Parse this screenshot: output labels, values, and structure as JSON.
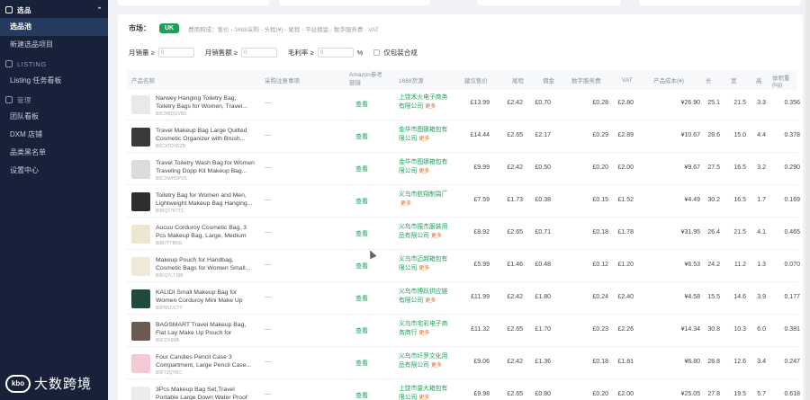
{
  "sidebar": {
    "sections": [
      {
        "label": "选品",
        "items": [
          {
            "label": "选品池",
            "active": true
          },
          {
            "label": "新建选品项目",
            "active": false
          }
        ]
      },
      {
        "label": "LISTING",
        "items": [
          {
            "label": "Listing 任务看板",
            "active": false
          }
        ]
      },
      {
        "label": "管理",
        "items": [
          {
            "label": "团队看板",
            "active": false
          },
          {
            "label": "DXM 店铺",
            "active": false
          },
          {
            "label": "品类黑名单",
            "active": false
          },
          {
            "label": "设置中心",
            "active": false
          }
        ]
      }
    ],
    "brand": {
      "logo": "kbo",
      "name": "大数跨境"
    }
  },
  "filters": {
    "market_label": "市场：",
    "market_value": "UK",
    "fee_text": "费用构成：售价 - 1688采购 - 头程(¥) - 尾程 - 平台佣金 - 数字服务费 - VAT",
    "monthly_sales_label": "月销量 ≥",
    "monthly_sales_value": "0",
    "monthly_revenue_label": "月销售额 ≥",
    "monthly_revenue_value": "0",
    "margin_label": "毛利率 ≥",
    "margin_value": "0",
    "margin_unit": "%",
    "compliant_label": "仅包装合规"
  },
  "table": {
    "columns": [
      "产品名称",
      "采购注意事项",
      "Amazon参考链接",
      "1688货源",
      "建议售价",
      "尾程",
      "佣金",
      "数字服务费",
      "VAT",
      "产品成本(¥)",
      "长",
      "宽",
      "高",
      "体积重(kg)"
    ],
    "link_label": "查看",
    "more_label": "更多",
    "note_placeholder": "—",
    "rows": [
      {
        "name": "Narwey Hanging Toiletry Bag, Toiletry Bags for Women, Travel...",
        "asin": "B0CHBQGVB9",
        "source": "上饶禾火电子商务有限公司",
        "price": "£13.99",
        "tail": "£2.42",
        "comm": "£0.70",
        "dst": "£0.28",
        "vat": "£2.80",
        "cost": "¥26.90",
        "l": "25.1",
        "w": "21.5",
        "h": "3.3",
        "vw": "0.356",
        "thumb": "#e9e9e9"
      },
      {
        "name": "Travel Makeup Bag Large Quilted Cosmetic Organizer with Brush...",
        "asin": "B0CXTDYRZB",
        "source": "金华市图娜箱包有限公司",
        "price": "£14.44",
        "tail": "£2.65",
        "comm": "£2.17",
        "dst": "£0.29",
        "vat": "£2.89",
        "cost": "¥10.67",
        "l": "28.6",
        "w": "15.0",
        "h": "4.4",
        "vw": "0.378",
        "thumb": "#3a3a3a"
      },
      {
        "name": "Travel Toiletry Wash Bag for Women Traveling Dopp Kit Makeup Bag...",
        "asin": "B0CXWHDPZS",
        "source": "金华市图娜箱包有限公司",
        "price": "£9.99",
        "tail": "£2.42",
        "comm": "£0.50",
        "dst": "£0.20",
        "vat": "£2.00",
        "cost": "¥9.67",
        "l": "27.5",
        "w": "16.5",
        "h": "3.2",
        "vw": "0.290",
        "thumb": "#dcdcdc"
      },
      {
        "name": "Toiletry Bag for Women and Men, Lightweight Makeup Bag Hanging...",
        "asin": "B0BQ17K7T1",
        "source": "义乌市航翔制袋厂",
        "price": "£7.59",
        "tail": "£1.73",
        "comm": "£0.38",
        "dst": "£0.15",
        "vat": "£1.52",
        "cost": "¥4.49",
        "l": "30.2",
        "w": "16.5",
        "h": "1.7",
        "vw": "0.169",
        "thumb": "#2e2e2e"
      },
      {
        "name": "Aucuu Corduroy Cosmetic Bag, 3 Pcs Makeup Bag, Large, Medium and...",
        "asin": "B0B7TYBNS",
        "source": "义乌市振杰服装用品有限公司",
        "price": "£8.92",
        "tail": "£2.65",
        "comm": "£0.71",
        "dst": "£0.18",
        "vat": "£1.78",
        "cost": "¥31.95",
        "l": "26.4",
        "w": "21.5",
        "h": "4.1",
        "vw": "0.465",
        "thumb": "#efe6d2"
      },
      {
        "name": "Makeup Pouch for Handbag, Cosmetic Bags for Women Small...",
        "asin": "B0FQYL7J9B",
        "source": "义乌市迈越箱包有限公司",
        "price": "£5.99",
        "tail": "£1.46",
        "comm": "£0.48",
        "dst": "£0.12",
        "vat": "£1.20",
        "cost": "¥6.53",
        "l": "24.2",
        "w": "11.2",
        "h": "1.3",
        "vw": "0.070",
        "thumb": "#f0e8d8"
      },
      {
        "name": "KALIDI Small Makeup Bag for Women Corduroy Mini Make Up Pouch with...",
        "asin": "B0FMLDCTY",
        "source": "义乌市博跃供应链有限公司",
        "price": "£11.99",
        "tail": "£2.42",
        "comm": "£1.80",
        "dst": "£0.24",
        "vat": "£2.40",
        "cost": "¥4.58",
        "l": "15.5",
        "w": "14.6",
        "h": "3.9",
        "vw": "0.177",
        "thumb": "#1f4a3c"
      },
      {
        "name": "BAGSMART Travel Makeup Bag, Flat Lay Make Up Pouch for Women,...",
        "asin": "B0CDX9M6",
        "source": "义乌市宅彩电子商务商行",
        "price": "£11.32",
        "tail": "£2.65",
        "comm": "£1.70",
        "dst": "£0.23",
        "vat": "£2.26",
        "cost": "¥14.34",
        "l": "30.8",
        "w": "10.3",
        "h": "6.0",
        "vw": "0.381",
        "thumb": "#6b5a52"
      },
      {
        "name": "Four Candies Pencil Case 3 Compartment, Large Pencil Case...",
        "asin": "B0F7JQYRC",
        "source": "义乌市纤罗文化用品有限公司",
        "price": "£9.06",
        "tail": "£2.42",
        "comm": "£1.36",
        "dst": "£0.18",
        "vat": "£1.81",
        "cost": "¥6.80",
        "l": "28.8",
        "w": "12.6",
        "h": "3.4",
        "vw": "0.247",
        "thumb": "#f3c9d4"
      },
      {
        "name": "3Pcs Makeup Bag Set,Travel Portable Large Down Water Proof Cosmetic...",
        "asin": "B0FSMWKM",
        "source": "上饶市量大箱包有限公司",
        "price": "£9.98",
        "tail": "£2.65",
        "comm": "£0.80",
        "dst": "£0.20",
        "vat": "£2.00",
        "cost": "¥25.05",
        "l": "27.8",
        "w": "19.5",
        "h": "5.7",
        "vw": "0.618",
        "thumb": "#ececec"
      }
    ]
  }
}
